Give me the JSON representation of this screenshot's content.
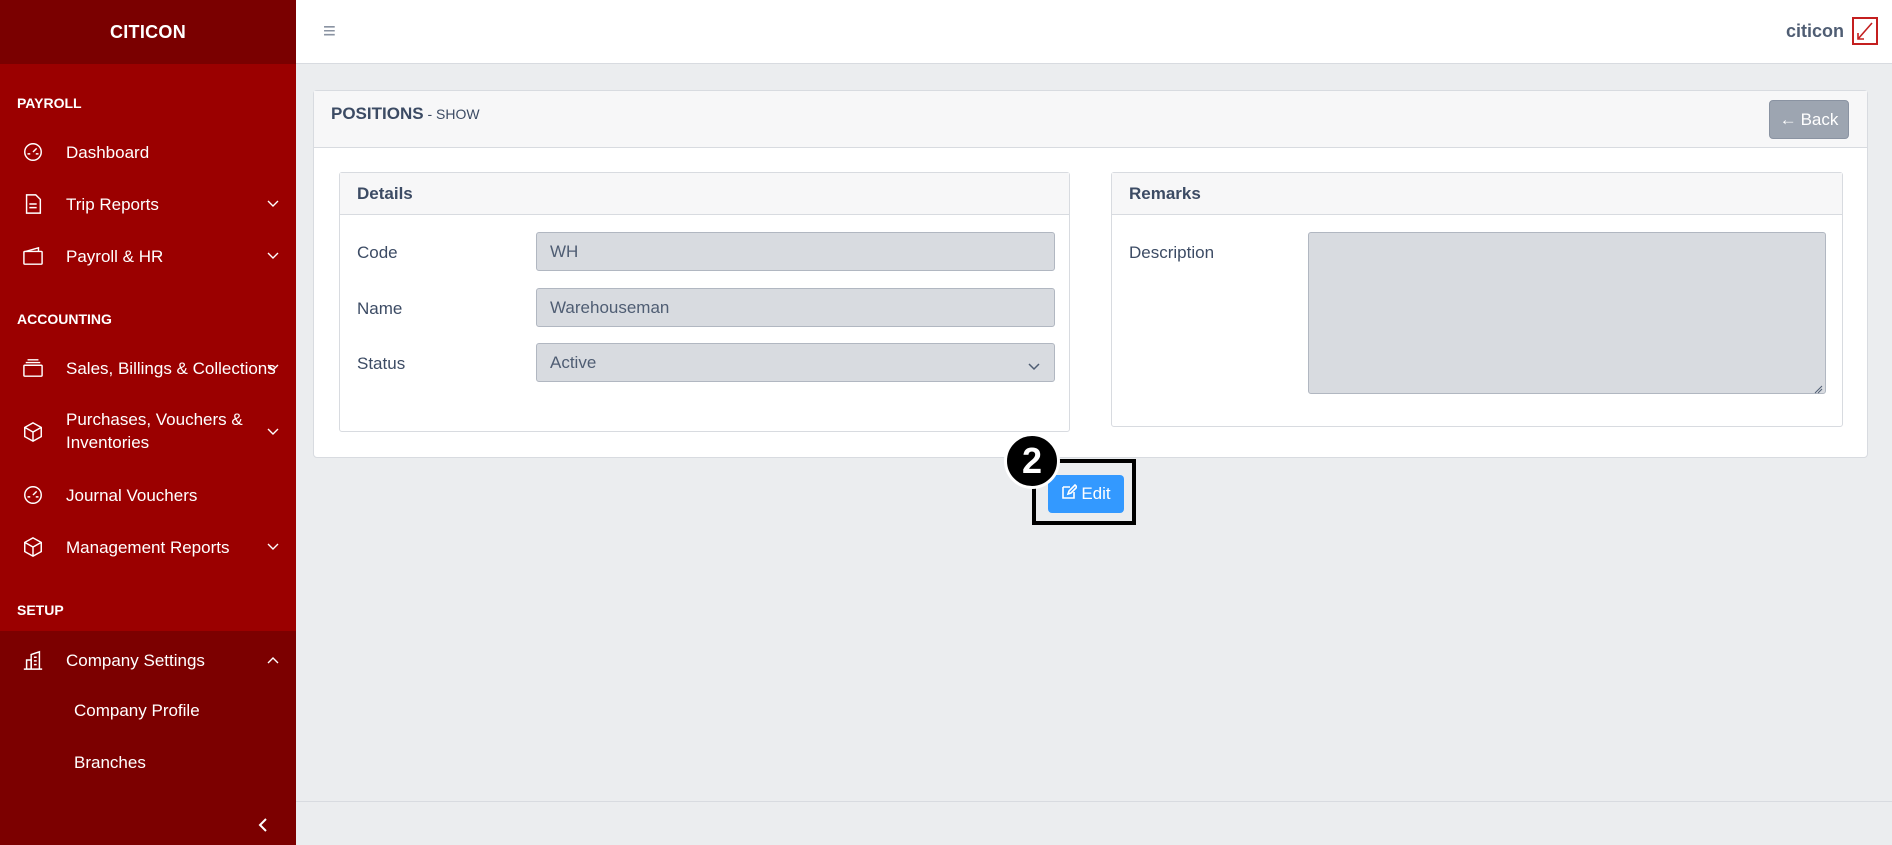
{
  "sidebar": {
    "brand": "CITICON",
    "sections": {
      "payroll": "PAYROLL",
      "accounting": "ACCOUNTING",
      "setup": "SETUP"
    },
    "items": {
      "dashboard": "Dashboard",
      "trip_reports": "Trip Reports",
      "payroll_hr": "Payroll & HR",
      "sales": "Sales, Billings & Collections",
      "purchases": "Purchases, Vouchers & Inventories",
      "journal": "Journal Vouchers",
      "management": "Management Reports",
      "company_settings": "Company Settings",
      "company_profile": "Company Profile",
      "branches": "Branches"
    }
  },
  "header": {
    "menu_icon": "≡",
    "username": "citicon"
  },
  "card": {
    "title": "POSITIONS",
    "subtitle": " - SHOW",
    "back_label": "Back",
    "back_arrow": "←"
  },
  "details": {
    "title": "Details",
    "code_label": "Code",
    "code_value": "WH",
    "name_label": "Name",
    "name_value": "Warehouseman",
    "status_label": "Status",
    "status_value": "Active"
  },
  "remarks": {
    "title": "Remarks",
    "description_label": "Description",
    "description_value": ""
  },
  "actions": {
    "edit_label": "Edit",
    "step_number": "2"
  },
  "colors": {
    "sidebar": "#9b0000",
    "sidebar_dark": "#7a0000",
    "primary": "#3399ff",
    "secondary": "#9da5b1"
  }
}
